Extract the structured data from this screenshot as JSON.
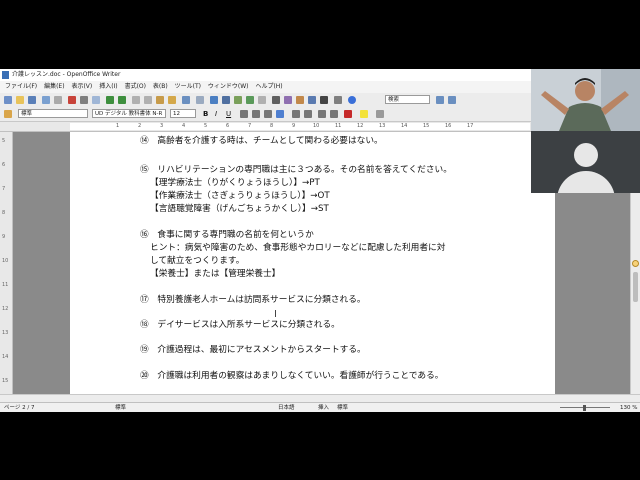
{
  "window": {
    "title": "介護レッスン.doc - OpenOffice Writer"
  },
  "menu": [
    "ファイル(F)",
    "編集(E)",
    "表示(V)",
    "挿入(I)",
    "書式(O)",
    "表(B)",
    "ツール(T)",
    "ウィンドウ(W)",
    "ヘルプ(H)"
  ],
  "toolbar": {
    "style": "標準",
    "font": "UD デジタル 教科書体 N-R",
    "size": "12",
    "search_placeholder": "検索"
  },
  "ruler_ticks": [
    "1",
    "2",
    "3",
    "4",
    "5",
    "6",
    "7",
    "8",
    "9",
    "10",
    "11",
    "12",
    "13",
    "14",
    "15",
    "16",
    "17"
  ],
  "vruler_ticks": [
    "5",
    "6",
    "7",
    "8",
    "9",
    "10",
    "11",
    "12",
    "13",
    "14",
    "15"
  ],
  "document": {
    "lines": [
      "⑭　高齢者を介護する時は、チームとして関わる必要はない。",
      "⑮　リハビリテーションの専門職は主に３つある。その名前を答えてください。",
      "【理学療法士（りがくりょうほうし）】→PT",
      "【作業療法士（さぎょうりょうほうし）】→OT",
      "【言語聴覚障害（げんごちょうかくし）】→ST",
      "⑯　食事に関する専門職の名前を何というか",
      "ヒント：病気や障害のため、食事形態やカロリーなどに配慮した利用者に対",
      "して献立をつくります。",
      "【栄養士】または【管理栄養士】",
      "⑰　特別養護老人ホームは訪問系サービスに分類される。",
      "⑱　デイサービスは入所系サービスに分類される。",
      "⑲　介護過程は、最初にアセスメントからスタートする。",
      "⑳　介護職は利用者の観察はあまりしなくていい。看護師が行うことである。"
    ]
  },
  "status": {
    "page": "ページ 2 / 7",
    "style": "標準",
    "language": "日本語",
    "mode": "挿入",
    "select": "標準",
    "zoom": "130 %"
  }
}
